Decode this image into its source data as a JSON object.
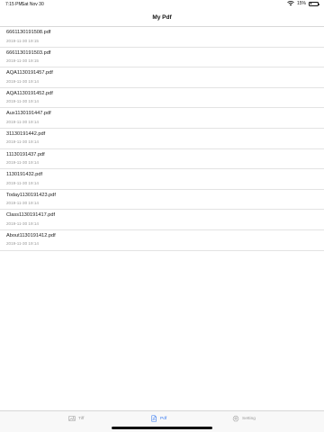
{
  "status_bar": {
    "time": "7:15 PM",
    "date": "Sat Nov 30",
    "battery": "15%",
    "battery_level": 0.15
  },
  "nav": {
    "title": "My Pdf"
  },
  "files": [
    {
      "name": "6661130191508.pdf",
      "date": "2019-11-30 19:15"
    },
    {
      "name": "6661130191503.pdf",
      "date": "2019-11-30 19:15"
    },
    {
      "name": "AQA1130191457.pdf",
      "date": "2019-11-30 19:14"
    },
    {
      "name": "AQA1130191452.pdf",
      "date": "2019-11-30 19:14"
    },
    {
      "name": "Aux1130191447.pdf",
      "date": "2019-11-30 19:14"
    },
    {
      "name": "31130191442.pdf",
      "date": "2019-11-30 19:14"
    },
    {
      "name": "11130191437.pdf",
      "date": "2019-11-30 19:14"
    },
    {
      "name": "1130191432.pdf",
      "date": "2019-11-30 19:14"
    },
    {
      "name": "Today1130191423.pdf",
      "date": "2019-11-30 19:14"
    },
    {
      "name": "Class1130191417.pdf",
      "date": "2019-11-30 19:14"
    },
    {
      "name": "About1130191412.pdf",
      "date": "2019-11-30 19:14"
    }
  ],
  "tabs": [
    {
      "label": "Tiff",
      "icon": "image-icon",
      "active": false
    },
    {
      "label": "Pdf",
      "icon": "pdf-document-icon",
      "active": true
    },
    {
      "label": "Setting",
      "icon": "gear-icon",
      "active": false
    }
  ],
  "colors": {
    "accent": "#3a7cf2",
    "inactive": "#9a9a9a"
  }
}
